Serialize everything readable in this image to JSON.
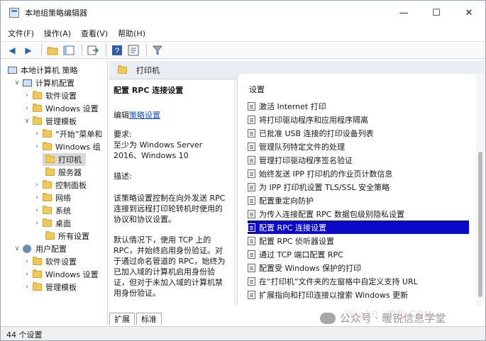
{
  "window": {
    "title": "本地组策略编辑器",
    "controls": {
      "minimize": "—",
      "maximize": "☐",
      "close": "✕"
    }
  },
  "menu": [
    "文件(F)",
    "操作(A)",
    "查看(V)",
    "帮助(H)"
  ],
  "toolbar": {
    "icons": [
      "back-icon",
      "forward-icon",
      "up-icon",
      "view-icon",
      "export-icon",
      "help-icon",
      "properties-icon",
      "filter-icon"
    ]
  },
  "tree": [
    {
      "label": "本地计算机 策略",
      "icon": "computer-policy"
    },
    {
      "label": "计算机配置",
      "icon": "computer"
    },
    {
      "label": "软件设置",
      "icon": "folder"
    },
    {
      "label": "Windows 设置",
      "icon": "folder"
    },
    {
      "label": "管理模板",
      "icon": "folder"
    },
    {
      "label": "“开始”菜单和",
      "icon": "folder"
    },
    {
      "label": "Windows 组",
      "icon": "folder"
    },
    {
      "label": "打印机",
      "icon": "folder"
    },
    {
      "label": "服务器",
      "icon": "folder"
    },
    {
      "label": "控制面板",
      "icon": "folder"
    },
    {
      "label": "网络",
      "icon": "folder"
    },
    {
      "label": "系统",
      "icon": "folder"
    },
    {
      "label": "桌面",
      "icon": "folder"
    },
    {
      "label": "所有设置",
      "icon": "folder"
    },
    {
      "label": "用户配置",
      "icon": "user"
    },
    {
      "label": "软件设置",
      "icon": "folder"
    },
    {
      "label": "Windows 设置",
      "icon": "folder"
    },
    {
      "label": "管理模板",
      "icon": "folder"
    }
  ],
  "header": {
    "title": "打印机"
  },
  "description": {
    "title": "配置 RPC 连接设置",
    "edit_prefix": "编辑",
    "edit_link": "策略设置",
    "requirements_label": "要求:",
    "requirements": "至少为 Windows Server 2016、Windows 10",
    "description_label": "描述:",
    "body": "该策略设置控制在向外发送 RPC 连接到远程打印轮转机时使用的协议和协议设置。",
    "body2": "默认情况下，使用 TCP 上的 RPC，并始终启用身份验证。对于通过命名管道的 RPC，始终为已加入域的计算机启用身份验证，但对于未加入域的计算机禁用身份验证。"
  },
  "list": {
    "header": "设置",
    "items": [
      "激活 Internet 打印",
      "将打印驱动程序和应用程序隔离",
      "已批准 USB 连接的打印设备列表",
      "管理队列特定文件的处理",
      "管理打印驱动程序签名验证",
      "始终发送 IPP 打印机的作业页计数信息",
      "为 IPP 打印机设置 TLS/SSL 安全策略",
      "配置重定向防护",
      "为传入连接配置 RPC 数据包级别隐私设置",
      "配置 RPC 连接设置",
      "配置 RPC 侦听器设置",
      "通过 TCP 端口配置 RPC",
      "配置受 Windows 保护的打印",
      "在“打印机”文件夹的左窗格中自定义支持 URL",
      "扩展指向和打印连接以搜索 Windows 更新"
    ],
    "selected_index": 9
  },
  "tabs": [
    "扩展",
    "标准"
  ],
  "status": "44 个设置",
  "watermark": "公众号 · 暖锐信息学堂",
  "watermark2": "Win10 XTZJ.COM",
  "colors": {
    "selection": "#0a0ac8",
    "folder": "#f0c95c",
    "link": "#1155cc"
  }
}
